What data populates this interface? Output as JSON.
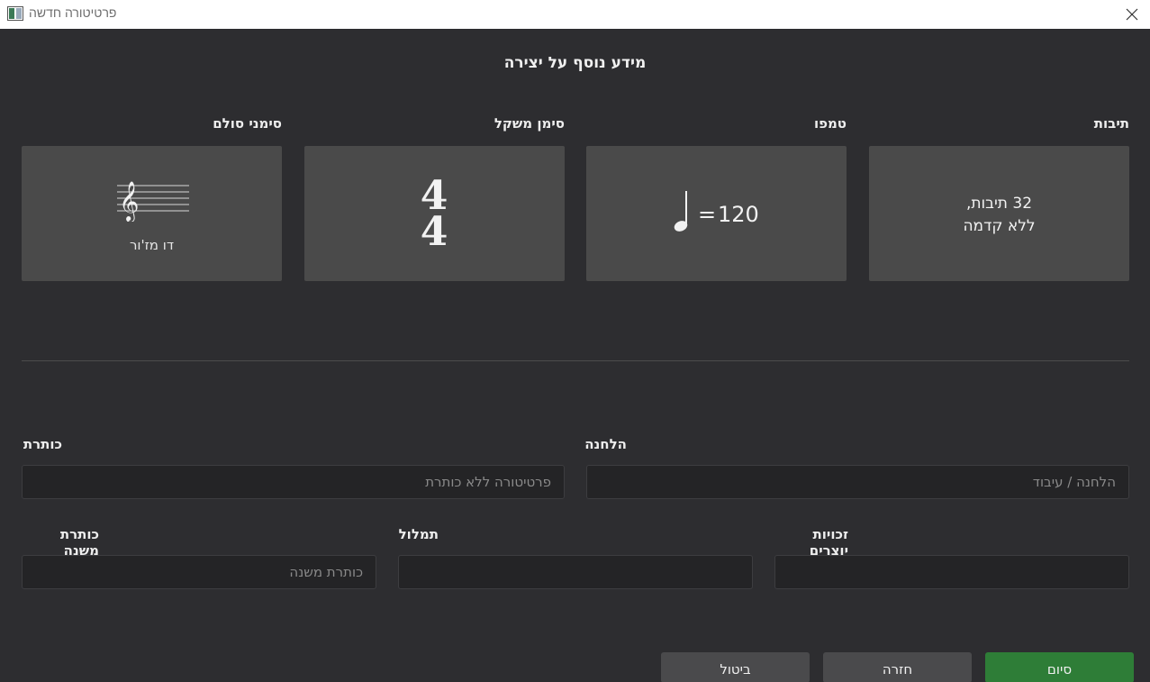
{
  "window": {
    "title": "פרטיטורה חדשה",
    "icon": "app-window-icon",
    "close_icon": "close-icon"
  },
  "heading": "מידע נוסף על יצירה",
  "cards": {
    "measures": {
      "label": "תיבות",
      "line1": "32 תיבות,",
      "line2": "ללא קדמה"
    },
    "tempo": {
      "label": "טמפו",
      "equals": "=",
      "value": "120",
      "icon": "quarter-note-icon"
    },
    "time_signature": {
      "label": "סימן משקל",
      "numerator": "4",
      "denominator": "4"
    },
    "key_signature": {
      "label": "סימני סולם",
      "key_name": "דו מז'ור",
      "icon": "treble-clef-staff-icon"
    }
  },
  "fields": {
    "title": {
      "label": "כותרת",
      "placeholder": "פרטיטורה ללא כותרת",
      "value": ""
    },
    "composer": {
      "label": "הלחנה",
      "placeholder": "הלחנה / עיבוד",
      "value": ""
    },
    "subtitle": {
      "label": "כותרת משנה",
      "placeholder": "כותרת משנה",
      "value": ""
    },
    "lyricist": {
      "label": "תמלול",
      "placeholder": "",
      "value": ""
    },
    "copyright": {
      "label": "זכויות יוצרים",
      "placeholder": "",
      "value": ""
    }
  },
  "buttons": {
    "cancel": "ביטול",
    "back": "חזרה",
    "finish": "סיום"
  },
  "colors": {
    "background": "#2d2d30",
    "card": "#4a4a4a",
    "field": "#242426",
    "finish_button": "#2e7d37",
    "secondary_button": "#4a4a4c"
  }
}
